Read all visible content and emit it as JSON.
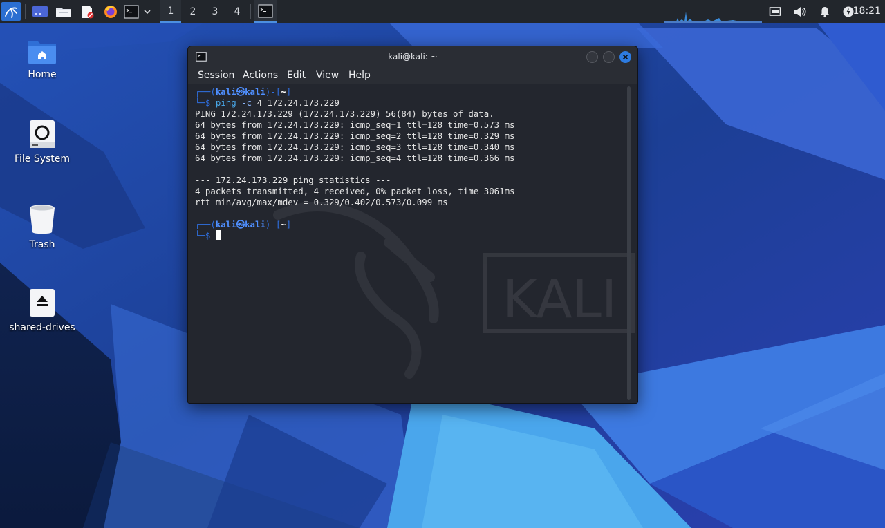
{
  "panel": {
    "workspaces": [
      "1",
      "2",
      "3",
      "4"
    ],
    "active_workspace": "1",
    "clock": "18:21"
  },
  "desktop": {
    "icons": [
      {
        "label": "Home"
      },
      {
        "label": "File System"
      },
      {
        "label": "Trash"
      },
      {
        "label": "shared-drives"
      }
    ]
  },
  "terminal": {
    "title": "kali@kali: ~",
    "menu": [
      "Session",
      "Actions",
      "Edit",
      "View",
      "Help"
    ],
    "prompt": {
      "user": "kali",
      "at": "㉿",
      "host": "kali",
      "dir": "~",
      "line1_open": "┌──(",
      "line1_mid": ")-[",
      "line1_close": "]",
      "line2": "└─$"
    },
    "command": {
      "bin": "ping",
      "flag": "-c",
      "args": "4 172.24.173.229"
    },
    "output": {
      "l1": "PING 172.24.173.229 (172.24.173.229) 56(84) bytes of data.",
      "l2": "64 bytes from 172.24.173.229: icmp_seq=1 ttl=128 time=0.573 ms",
      "l3": "64 bytes from 172.24.173.229: icmp_seq=2 ttl=128 time=0.329 ms",
      "l4": "64 bytes from 172.24.173.229: icmp_seq=3 ttl=128 time=0.340 ms",
      "l5": "64 bytes from 172.24.173.229: icmp_seq=4 ttl=128 time=0.366 ms",
      "l6": "--- 172.24.173.229 ping statistics ---",
      "l7": "4 packets transmitted, 4 received, 0% packet loss, time 3061ms",
      "l8": "rtt min/avg/max/mdev = 0.329/0.402/0.573/0.099 ms"
    },
    "watermark_text": "KALI"
  },
  "colors": {
    "panel_bg": "#22262c",
    "terminal_bg": "#23262e",
    "prompt_blue": "#2f6fe0",
    "close_button": "#2d7be0"
  }
}
